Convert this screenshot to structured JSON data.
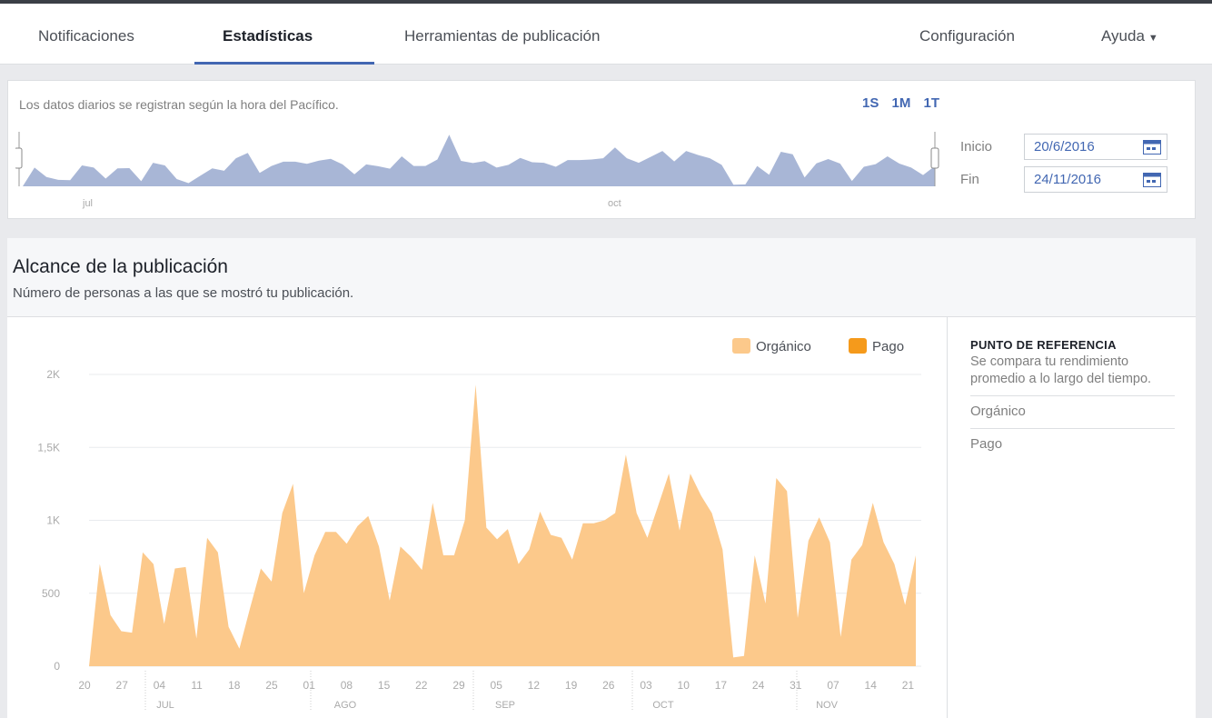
{
  "nav": {
    "tabs": [
      "Notificaciones",
      "Estadísticas",
      "Herramientas de publicación"
    ],
    "active_tab": "Estadísticas",
    "right": [
      "Configuración",
      "Ayuda"
    ]
  },
  "range": {
    "note": "Los datos diarios se registran según la hora del Pacífico.",
    "zoom_options": [
      "1S",
      "1M",
      "1T"
    ],
    "mini_ticks": [
      "jul",
      "oct"
    ],
    "start_label": "Inicio",
    "start_value": "20/6/2016",
    "end_label": "Fin",
    "end_value": "24/11/2016"
  },
  "section": {
    "title": "Alcance de la publicación",
    "subtitle": "Número de personas a las que se mostró tu publicación."
  },
  "benchmark": {
    "title": "PUNTO DE REFERENCIA",
    "description": "Se compara tu rendimiento promedio a lo largo del tiempo.",
    "rows": [
      "Orgánico",
      "Pago"
    ]
  },
  "colors": {
    "organic": "#fcc98b",
    "paid": "#f59a1b",
    "mini": "#a8b6d6",
    "accent": "#4267b2"
  },
  "chart_data": {
    "type": "area",
    "xlabel": "",
    "ylabel": "",
    "ylim": [
      0,
      2000
    ],
    "y_ticks": [
      "0",
      "500",
      "1K",
      "1,5K",
      "2K"
    ],
    "y_tick_values": [
      0,
      500,
      1000,
      1500,
      2000
    ],
    "x_tick_labels": [
      "20",
      "27",
      "04",
      "11",
      "18",
      "25",
      "01",
      "08",
      "15",
      "22",
      "29",
      "05",
      "12",
      "19",
      "26",
      "03",
      "10",
      "17",
      "24",
      "31",
      "07",
      "14",
      "21"
    ],
    "month_labels": [
      "JUL",
      "AGO",
      "SEP",
      "OCT",
      "NOV"
    ],
    "legend": [
      "Orgánico",
      "Pago"
    ],
    "series": [
      {
        "name": "Orgánico",
        "values": [
          0,
          700,
          350,
          240,
          230,
          780,
          700,
          290,
          670,
          680,
          190,
          880,
          780,
          270,
          120,
          400,
          670,
          580,
          1050,
          1250,
          500,
          760,
          920,
          920,
          840,
          960,
          1030,
          820,
          450,
          820,
          750,
          660,
          1120,
          760,
          760,
          1000,
          1930,
          950,
          870,
          940,
          700,
          800,
          1060,
          900,
          880,
          730,
          980,
          980,
          1000,
          1050,
          1450,
          1050,
          880,
          1100,
          1320,
          930,
          1320,
          1170,
          1050,
          800,
          60,
          70,
          760,
          430,
          1290,
          1200,
          330,
          860,
          1020,
          850,
          200,
          730,
          830,
          1120,
          850,
          700,
          420,
          760
        ]
      },
      {
        "name": "Pago",
        "values": []
      }
    ]
  }
}
